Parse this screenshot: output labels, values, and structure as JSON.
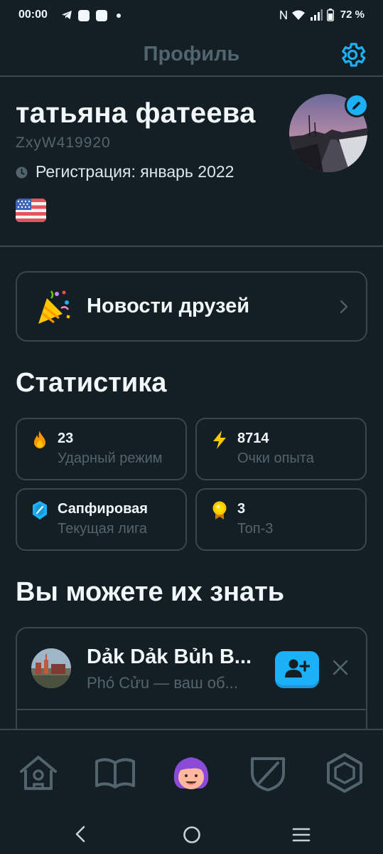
{
  "status_bar": {
    "time": "00:00",
    "battery": "72 %"
  },
  "header": {
    "title": "Профиль"
  },
  "profile": {
    "name": "татьяна фатеева",
    "username": "ZxyW419920",
    "registration": "Регистрация: январь 2022"
  },
  "friends_news": {
    "label": "Новости друзей"
  },
  "statistics": {
    "title": "Статистика",
    "items": [
      {
        "value": "23",
        "label": "Ударный режим",
        "icon": "flame-icon",
        "color": "#ff9600"
      },
      {
        "value": "8714",
        "label": "Очки опыта",
        "icon": "lightning-icon",
        "color": "#ffc800"
      },
      {
        "value": "Сапфировая",
        "label": "Текущая лига",
        "icon": "sapphire-league-icon",
        "color": "#1cb0f6"
      },
      {
        "value": "3",
        "label": "Топ-3",
        "icon": "medal-icon",
        "color": "#ffd900"
      }
    ]
  },
  "suggestions": {
    "title": "Вы можете их знать",
    "items": [
      {
        "name": "Dảk Dảk Bủh B...",
        "subtitle": "Phó Cửu — ваш об..."
      }
    ]
  },
  "tabs": [
    "home-tab",
    "learn-tab",
    "profile-tab",
    "leagues-tab",
    "shop-tab"
  ],
  "colors": {
    "background": "#131f24",
    "border": "#37464f",
    "muted": "#52656d",
    "accent": "#1cb0f6"
  }
}
